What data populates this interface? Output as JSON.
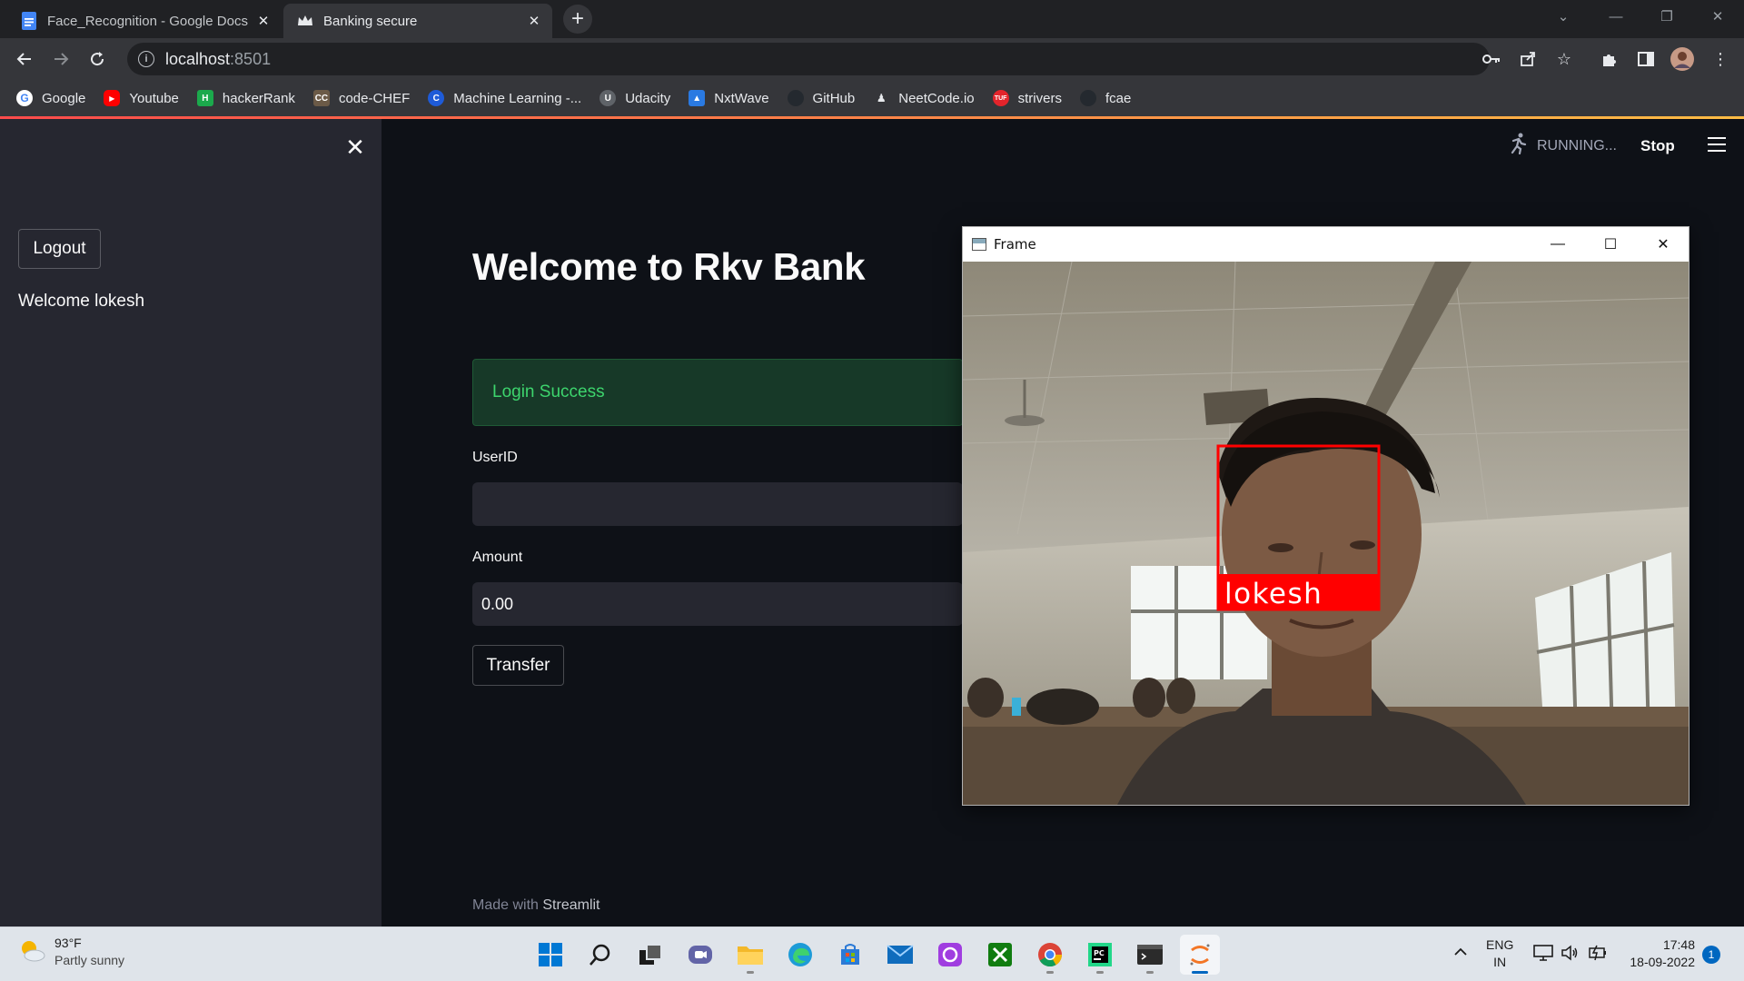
{
  "browser": {
    "tabs": [
      {
        "title": "Face_Recognition - Google Docs",
        "active": false
      },
      {
        "title": "Banking secure",
        "active": true
      }
    ],
    "url_host": "localhost",
    "url_port": ":8501",
    "bookmarks": [
      {
        "label": "Google",
        "icon": "google-icon"
      },
      {
        "label": "Youtube",
        "icon": "youtube-icon"
      },
      {
        "label": "hackerRank",
        "icon": "hackerrank-icon"
      },
      {
        "label": "code-CHEF",
        "icon": "codechef-icon"
      },
      {
        "label": "Machine Learning -...",
        "icon": "ml-course-icon"
      },
      {
        "label": "Udacity",
        "icon": "udacity-icon"
      },
      {
        "label": "NxtWave",
        "icon": "nxtwave-icon"
      },
      {
        "label": "GitHub",
        "icon": "github-icon"
      },
      {
        "label": "NeetCode.io",
        "icon": "neetcode-icon"
      },
      {
        "label": "strivers",
        "icon": "strivers-icon"
      },
      {
        "label": "fcae",
        "icon": "fcae-icon"
      }
    ],
    "accent_colors": {
      "loading_start": "#ff4b4b",
      "loading_end": "#ffbd45"
    }
  },
  "sidebar": {
    "logout_label": "Logout",
    "welcome_text": "Welcome lokesh"
  },
  "header": {
    "running_label": "RUNNING...",
    "stop_label": "Stop"
  },
  "main": {
    "title": "Welcome to Rkv Bank",
    "alert_text": "Login Success",
    "userid_label": "UserID",
    "userid_value": "",
    "amount_label": "Amount",
    "amount_value": "0.00",
    "transfer_label": "Transfer",
    "footer_prefix": "Made with",
    "footer_brand": "Streamlit"
  },
  "frame_window": {
    "title": "Frame",
    "detected_name": "lokesh",
    "box_color": "#ff0000"
  },
  "taskbar": {
    "weather_temp": "93°F",
    "weather_desc": "Partly sunny",
    "lang_top": "ENG",
    "lang_bottom": "IN",
    "time": "17:48",
    "date": "18-09-2022",
    "notification_count": "1"
  }
}
